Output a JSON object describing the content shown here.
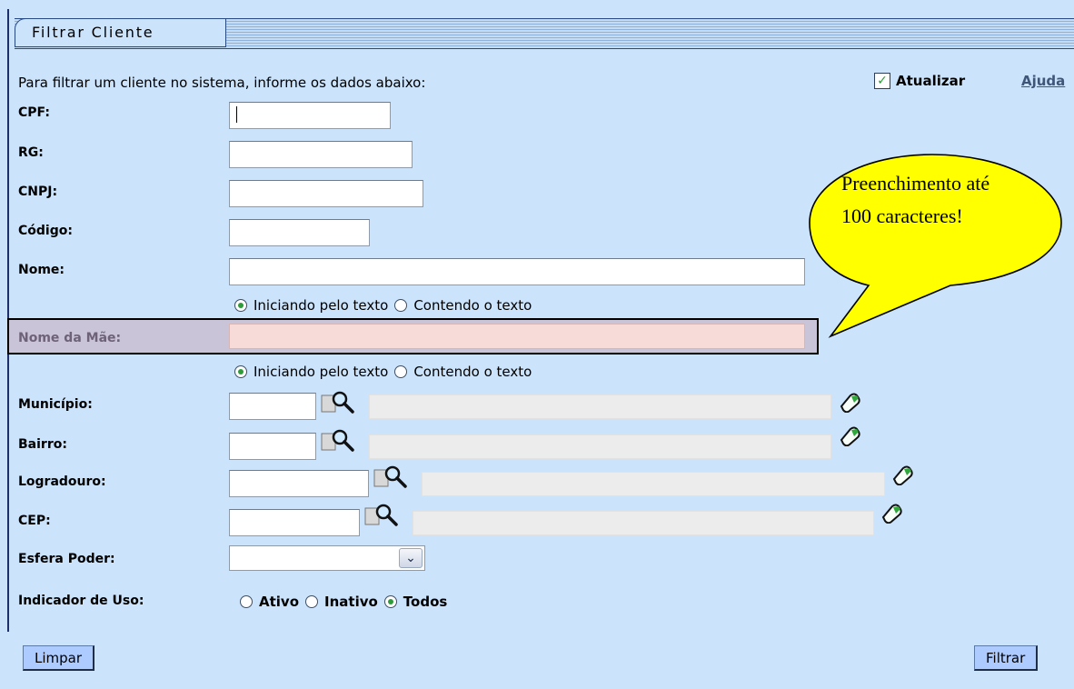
{
  "panel": {
    "title": "Filtrar Cliente"
  },
  "intro": "Para filtrar um cliente no sistema, informe os dados abaixo:",
  "atualizar": {
    "label": "Atualizar",
    "checked": true
  },
  "help": "Ajuda",
  "fields": {
    "cpf": "CPF:",
    "rg": "RG:",
    "cnpj": "CNPJ:",
    "codigo": "Código:",
    "nome": "Nome:",
    "nome_mae": "Nome da Mãe:",
    "municipio": "Município:",
    "bairro": "Bairro:",
    "logradouro": "Logradouro:",
    "cep": "CEP:",
    "esfera": "Esfera Poder:",
    "indicador": "Indicador de Uso:"
  },
  "nome_options": {
    "start": "Iniciando pelo texto",
    "contains": "Contendo o texto",
    "selected": "start"
  },
  "mae_options": {
    "start": "Iniciando pelo texto",
    "contains": "Contendo o texto",
    "selected": "start"
  },
  "uso_options": {
    "ativo": "Ativo",
    "inativo": "Inativo",
    "todos": "Todos",
    "selected": "todos"
  },
  "buttons": {
    "limpar": "Limpar",
    "filtrar": "Filtrar"
  },
  "callout": "Preenchimento até 100 caracteres!",
  "icons": {
    "search": "magnifier-icon",
    "clear": "eraser-icon",
    "dropdown": "chevron-down-icon"
  },
  "colors": {
    "background": "#cbe3fb",
    "callout_fill": "#ffff00",
    "button_fill": "#aecbff",
    "highlight_field": "#f7dbd9"
  }
}
